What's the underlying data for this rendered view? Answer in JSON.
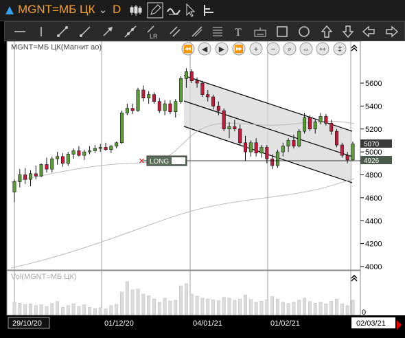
{
  "header": {
    "triangle_icon": "triangle-up-icon",
    "ticker": "MGNT=МБ ЦК",
    "interval": "D",
    "icons": [
      "candles-icon",
      "draw-pencil-icon",
      "link-wave-icon",
      "cursor-icon",
      "cursor-settings-icon"
    ]
  },
  "toolbar": {
    "tools": [
      "horizontal-line-icon",
      "vertical-line-icon",
      "trendline-icon",
      "ray-icon",
      "arrow-icon",
      "extended-line-icon",
      "regression-line-icon",
      "parallel-lines-icon",
      "andrews-pitchfork-icon",
      "fibonacci-icon",
      "text-icon",
      "keyboard-icon",
      "rectangle-icon",
      "ellipse-icon",
      "arrow-up-icon",
      "arrow-down-icon",
      "arrow-left-icon",
      "arrow-right-icon"
    ],
    "lr_label": "LR"
  },
  "chart_data": {
    "type": "candlestick",
    "title": "MGNT=МБ ЦК(Магнит ао)",
    "yticks": [
      4000,
      4200,
      4400,
      4600,
      4800,
      5000,
      5200,
      5400,
      5600
    ],
    "ylim": [
      3820,
      5800
    ],
    "xlabels": [
      "29/10/20",
      "01/12/20",
      "04/01/21",
      "01/02/21",
      "02/03/21"
    ],
    "last_price": 5070,
    "order_price": 4926,
    "order_label": "LONG",
    "volume_title": "Vol(MGNT=МБ ЦК)",
    "volume_axis_label": "0",
    "candles": [
      [
        4650,
        4760,
        4560,
        4740
      ],
      [
        4740,
        4850,
        4690,
        4800
      ],
      [
        4800,
        4860,
        4720,
        4760
      ],
      [
        4760,
        4840,
        4700,
        4810
      ],
      [
        4810,
        4880,
        4760,
        4790
      ],
      [
        4790,
        4900,
        4780,
        4890
      ],
      [
        4890,
        4950,
        4820,
        4850
      ],
      [
        4850,
        4960,
        4820,
        4940
      ],
      [
        4940,
        5000,
        4890,
        4960
      ],
      [
        4960,
        4990,
        4870,
        4900
      ],
      [
        4900,
        5000,
        4880,
        4980
      ],
      [
        4980,
        5030,
        4940,
        5010
      ],
      [
        5010,
        5050,
        4960,
        4970
      ],
      [
        4970,
        5020,
        4930,
        5000
      ],
      [
        5000,
        5050,
        4980,
        5010
      ],
      [
        5010,
        5060,
        4990,
        5030
      ],
      [
        5030,
        5070,
        5000,
        5040
      ],
      [
        5040,
        5080,
        5010,
        5020
      ],
      [
        5020,
        5060,
        4990,
        5050
      ],
      [
        5050,
        5090,
        5030,
        5080
      ],
      [
        5080,
        5360,
        5070,
        5340
      ],
      [
        5340,
        5420,
        5320,
        5380
      ],
      [
        5380,
        5420,
        5330,
        5360
      ],
      [
        5360,
        5560,
        5350,
        5540
      ],
      [
        5540,
        5580,
        5440,
        5470
      ],
      [
        5470,
        5530,
        5420,
        5500
      ],
      [
        5500,
        5520,
        5420,
        5440
      ],
      [
        5440,
        5470,
        5340,
        5360
      ],
      [
        5360,
        5450,
        5320,
        5420
      ],
      [
        5420,
        5450,
        5330,
        5350
      ],
      [
        5350,
        5460,
        5300,
        5440
      ],
      [
        5440,
        5660,
        5420,
        5640
      ],
      [
        5640,
        5730,
        5560,
        5700
      ],
      [
        5700,
        5720,
        5600,
        5620
      ],
      [
        5620,
        5650,
        5560,
        5600
      ],
      [
        5600,
        5620,
        5480,
        5500
      ],
      [
        5500,
        5540,
        5440,
        5480
      ],
      [
        5480,
        5500,
        5370,
        5400
      ],
      [
        5400,
        5440,
        5320,
        5360
      ],
      [
        5360,
        5380,
        5180,
        5200
      ],
      [
        5200,
        5260,
        5120,
        5220
      ],
      [
        5220,
        5280,
        5180,
        5200
      ],
      [
        5200,
        5240,
        5060,
        5080
      ],
      [
        5080,
        5140,
        4920,
        5000
      ],
      [
        5000,
        5100,
        4960,
        5080
      ],
      [
        5080,
        5120,
        4960,
        4990
      ],
      [
        4990,
        5060,
        4950,
        5040
      ],
      [
        5040,
        5060,
        4900,
        4940
      ],
      [
        4940,
        4980,
        4850,
        4880
      ],
      [
        4880,
        5020,
        4860,
        5000
      ],
      [
        5000,
        5080,
        4960,
        5050
      ],
      [
        5050,
        5120,
        5000,
        5100
      ],
      [
        5100,
        5150,
        5030,
        5050
      ],
      [
        5050,
        5200,
        5040,
        5180
      ],
      [
        5180,
        5340,
        5160,
        5300
      ],
      [
        5300,
        5320,
        5180,
        5200
      ],
      [
        5200,
        5280,
        5160,
        5260
      ],
      [
        5260,
        5340,
        5240,
        5310
      ],
      [
        5310,
        5330,
        5230,
        5250
      ],
      [
        5250,
        5280,
        5150,
        5180
      ],
      [
        5180,
        5200,
        5040,
        5060
      ],
      [
        5060,
        5080,
        4950,
        4970
      ],
      [
        4970,
        5000,
        4900,
        4930
      ],
      [
        4930,
        5090,
        4920,
        5070
      ]
    ],
    "volumes": [
      30,
      28,
      25,
      26,
      22,
      24,
      20,
      27,
      32,
      18,
      22,
      26,
      20,
      24,
      18,
      15,
      17,
      14,
      22,
      25,
      55,
      80,
      60,
      62,
      50,
      46,
      38,
      30,
      40,
      33,
      35,
      70,
      75,
      50,
      45,
      40,
      38,
      36,
      34,
      42,
      40,
      35,
      38,
      48,
      37,
      30,
      33,
      36,
      44,
      38,
      30,
      27,
      30,
      35,
      40,
      32,
      28,
      30,
      26,
      33,
      38,
      26,
      22,
      35
    ]
  }
}
